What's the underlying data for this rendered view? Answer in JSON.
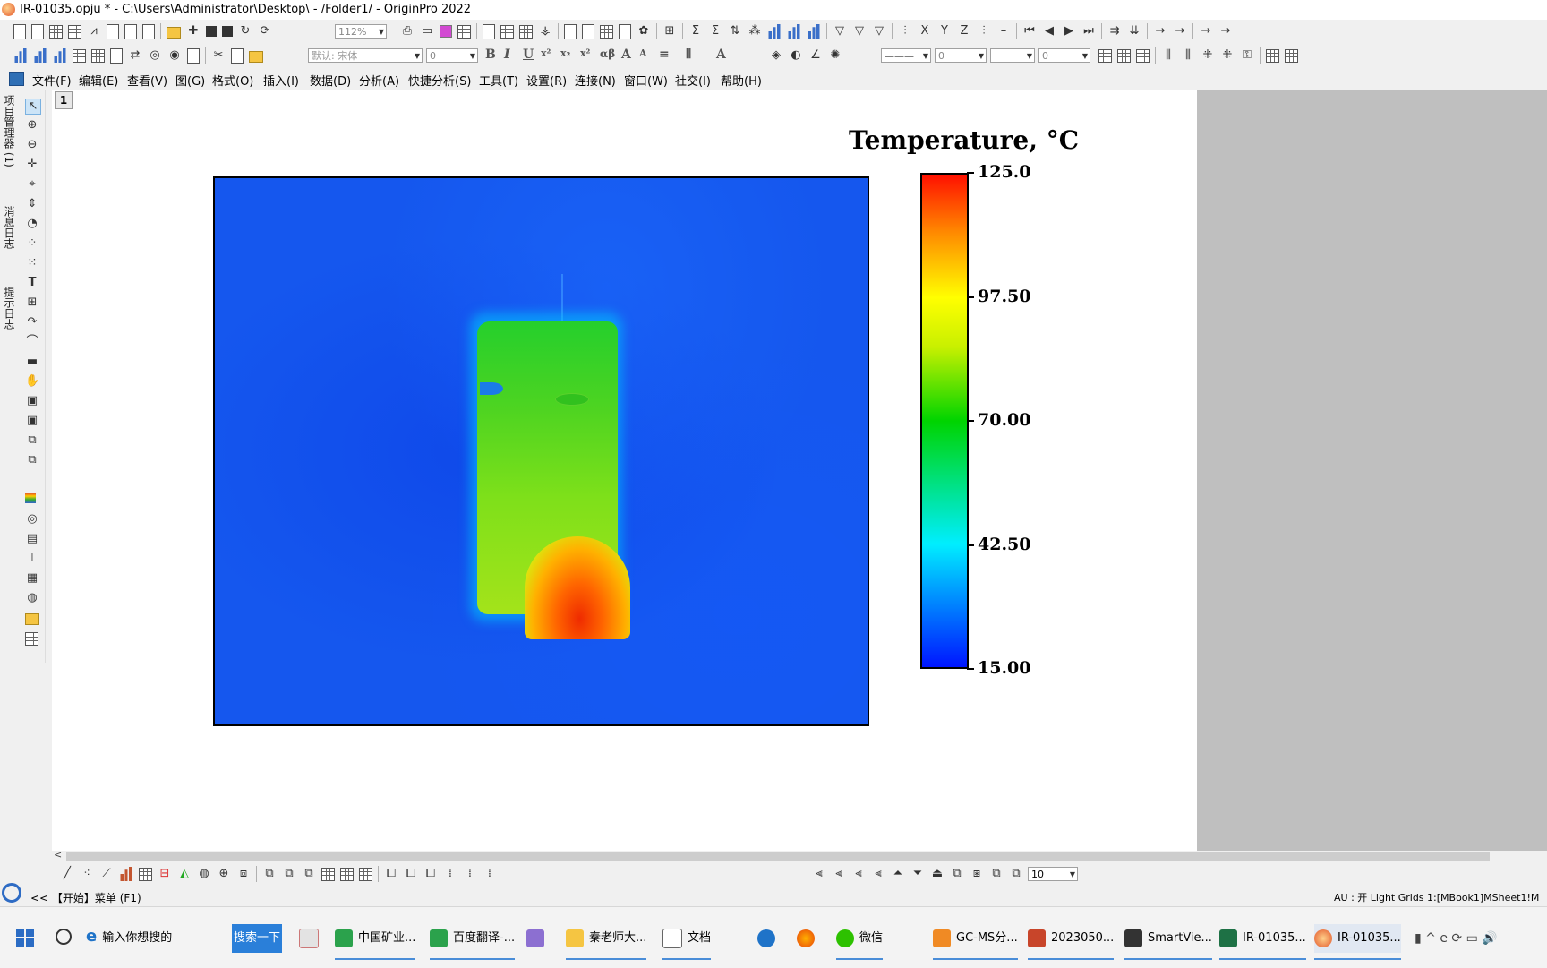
{
  "window": {
    "title": "IR-01035.opju * - C:\\Users\\Administrator\\Desktop\\ - /Folder1/ - OriginPro 2022"
  },
  "toolbar": {
    "zoom": "112%",
    "font_name": "默认: 宋体",
    "font_size": "0",
    "line_width": "0",
    "pattern_size": "0",
    "bottom_size": "10"
  },
  "menu": {
    "items": [
      "文件(F)",
      "编辑(E)",
      "查看(V)",
      "图(G)",
      "格式(O)",
      "插入(I)",
      "数据(D)",
      "分析(A)",
      "快捷分析(S)",
      "工具(T)",
      "设置(R)",
      "连接(N)",
      "窗口(W)",
      "社交(I)",
      "帮助(H)"
    ]
  },
  "side_panels": [
    "项目管理器 (1)",
    "消息日志",
    "提示日志"
  ],
  "graph": {
    "layer_tab": "1",
    "colorbar_title": "Temperature, °C",
    "colors": {
      "min": "#0015ff",
      "mid": "#00d400",
      "upper": "#ffff00",
      "max": "#ff1000",
      "background": "#1557ee"
    }
  },
  "chart_data": {
    "type": "heatmap",
    "title": "Temperature, °C",
    "colorbar": {
      "min": 15.0,
      "max": 125.0,
      "ticks": [
        15.0,
        42.5,
        70.0,
        97.5,
        125.0
      ],
      "tick_labels": [
        "15.00",
        "42.50",
        "70.00",
        "97.50",
        "125.0"
      ]
    },
    "description_values": {
      "background_approx": 20,
      "object_body_approx": 75,
      "hotspot_max_approx": 118
    }
  },
  "status": {
    "start_text": "<< 【开始】菜单 (F1)",
    "right_text": "AU : 开  Light Grids  1:[MBook1]MSheet1!M"
  },
  "taskbar": {
    "search_placeholder": "输入你想搜的",
    "search_button": "搜索一下",
    "tasks": [
      "中国矿业...",
      "百度翻译-...",
      "",
      "秦老师大...",
      "文档",
      "",
      "",
      "微信",
      "GC-MS分...",
      "2023050...",
      "SmartVie...",
      "IR-01035...",
      "IR-01035..."
    ]
  }
}
